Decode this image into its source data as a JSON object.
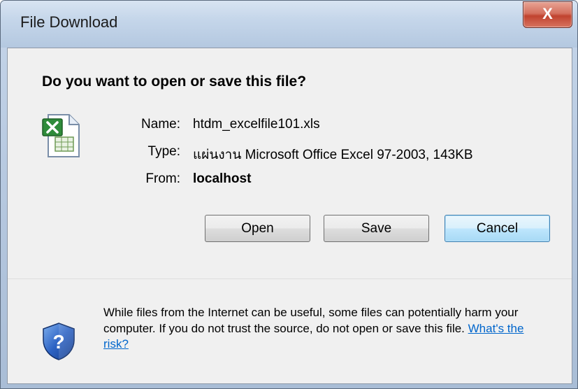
{
  "window": {
    "title": "File Download",
    "close_label": "X"
  },
  "dialog": {
    "question": "Do you want to open or save this file?",
    "file": {
      "name_label": "Name:",
      "name_value": "htdm_excelfile101.xls",
      "type_label": "Type:",
      "type_value": "แผ่นงาน Microsoft Office Excel 97-2003, 143KB",
      "from_label": "From:",
      "from_value": "localhost"
    },
    "buttons": {
      "open": "Open",
      "save": "Save",
      "cancel": "Cancel"
    },
    "warning": {
      "text": "While files from the Internet can be useful, some files can potentially harm your computer. If you do not trust the source, do not open or save this file.",
      "link": "What's the risk?"
    }
  },
  "icons": {
    "file": "excel-file-icon",
    "shield": "security-shield-icon"
  },
  "colors": {
    "default_button": "#a7d9f5",
    "link": "#0066cc",
    "close": "#c0432f"
  }
}
